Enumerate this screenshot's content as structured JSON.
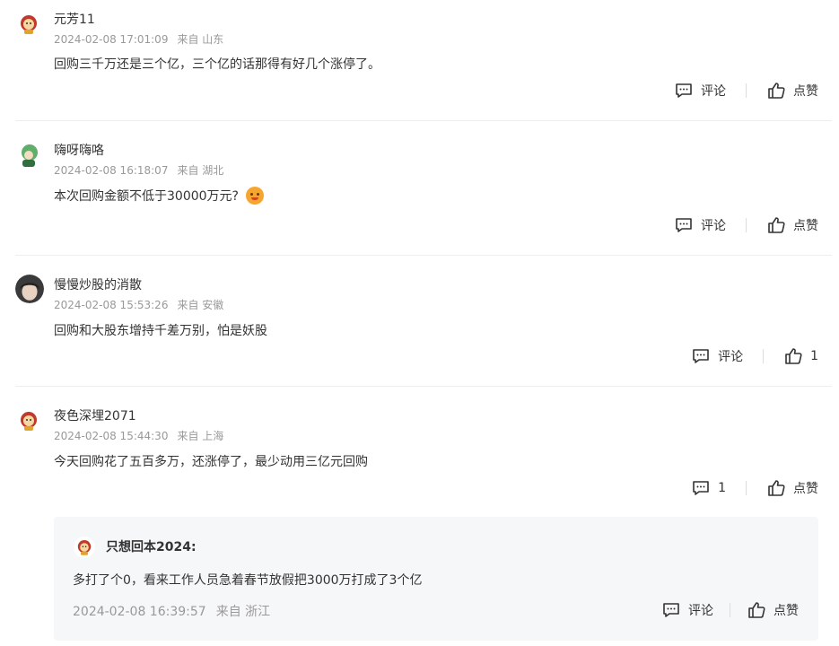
{
  "comments": [
    {
      "username": "元芳11",
      "time": "2024-02-08 17:01:09",
      "location": "来自 山东",
      "text": "回购三千万还是三个亿，三个亿的话那得有好几个涨停了。",
      "reply_label": "评论",
      "like_label": "点赞"
    },
    {
      "username": "嗨呀嗨咯",
      "time": "2024-02-08 16:18:07",
      "location": "来自 湖北",
      "text": "本次回购金额不低于30000万元?",
      "reply_label": "评论",
      "like_label": "点赞"
    },
    {
      "username": "慢慢炒股的消散",
      "time": "2024-02-08 15:53:26",
      "location": "来自 安徽",
      "text": "回购和大股东增持千差万别，怕是妖股",
      "reply_label": "评论",
      "like_label": "1"
    },
    {
      "username": "夜色深埋2071",
      "time": "2024-02-08 15:44:30",
      "location": "来自 上海",
      "text": "今天回购花了五百多万，还涨停了，最少动用三亿元回购",
      "reply_label": "1",
      "like_label": "点赞"
    }
  ],
  "reply": {
    "username": "只想回本2024:",
    "text": "多打了个0，看来工作人员急着春节放假把3000万打成了3个亿",
    "time": "2024-02-08 16:39:57",
    "location": "来自 浙江",
    "reply_label": "评论",
    "like_label": "点赞"
  },
  "icons": {
    "reply": "comment-icon",
    "like": "thumbs-up-icon",
    "emoji": "sweating-emoji-icon"
  }
}
